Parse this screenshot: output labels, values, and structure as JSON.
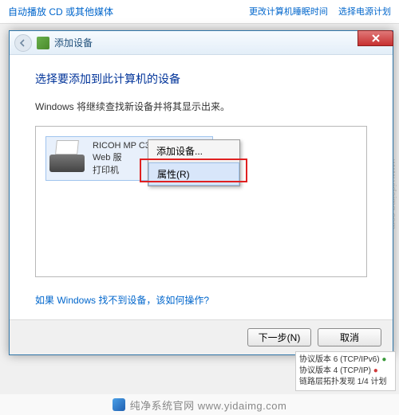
{
  "background": {
    "link_left": "自动播放 CD 或其他媒体",
    "link_right_1": "更改计算机睡眠时间",
    "link_right_2": "选择电源计划"
  },
  "dialog": {
    "title": "添加设备",
    "heading": "选择要添加到此计算机的设备",
    "subtext": "Windows 将继续查找新设备并将其显示出来。",
    "help_link": "如果 Windows 找不到设备，该如何操作?",
    "next_button": "下一步(N)",
    "cancel_button": "取消"
  },
  "device": {
    "name": "RICOH MP C3503",
    "line2": "Web 服",
    "line3": "打印机"
  },
  "context_menu": {
    "item_add": "添加设备...",
    "item_properties": "属性(R)"
  },
  "stray": {
    "row1": "协议版本 6 (TCP/IPv6)",
    "row2": "协议版本 4 (TCP/IP)",
    "row3": "链路层拓扑发现 1/4 计划"
  },
  "watermark": {
    "side": "www.yidaimg.com",
    "bottom": "纯净系统官网 www.yidaimg.com"
  }
}
